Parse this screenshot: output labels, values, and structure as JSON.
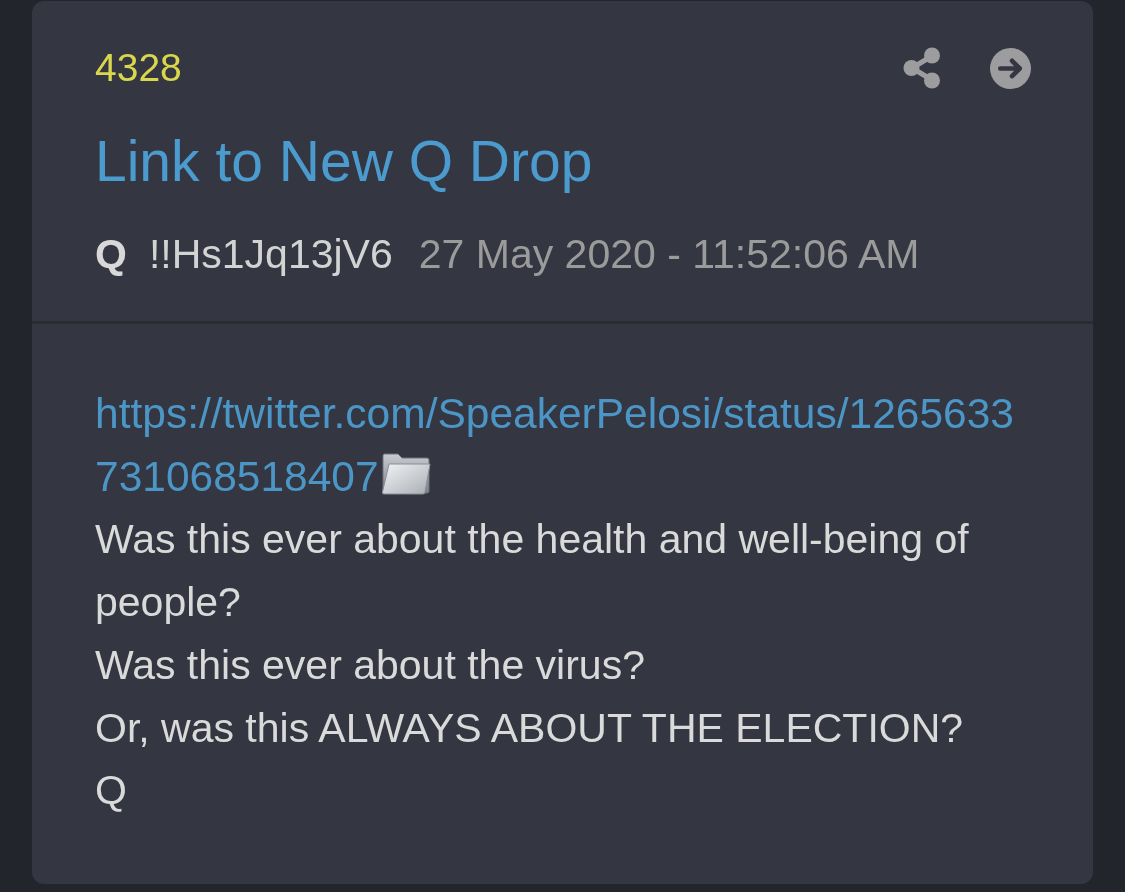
{
  "post": {
    "number": "4328",
    "title": "Link to New Q Drop",
    "author": "Q",
    "tripcode": "!!Hs1Jq13jV6",
    "timestamp": "27 May 2020 - 11:52:06 AM"
  },
  "body": [
    {
      "kind": "link",
      "text": "https://twitter.com/SpeakerPelosi/status/1265633731068518407"
    },
    {
      "kind": "text",
      "text": "Was this ever about the health and well-being of people?"
    },
    {
      "kind": "text",
      "text": "Was this ever about the virus?"
    },
    {
      "kind": "text",
      "text": "Or, was this ALWAYS ABOUT THE ELECTION?"
    },
    {
      "kind": "text",
      "text": "Q"
    }
  ]
}
